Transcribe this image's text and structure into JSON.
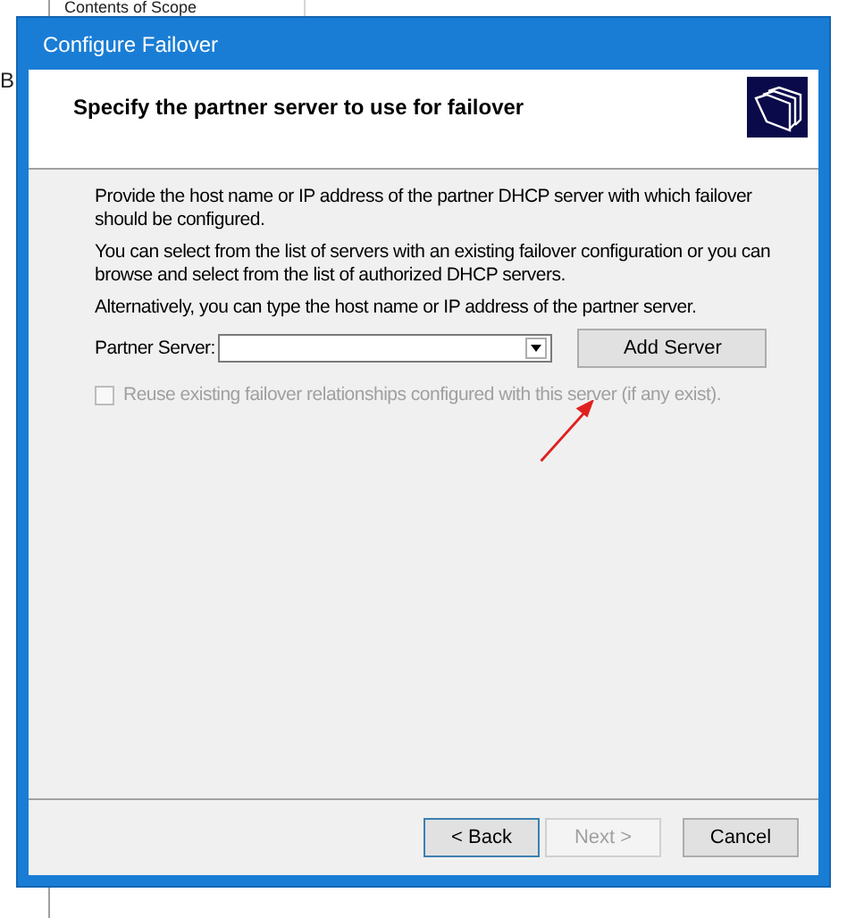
{
  "background": {
    "pane_header": "Contents of Scope",
    "left_fragment": "B"
  },
  "dialog": {
    "title": "Configure Failover",
    "heading": "Specify the partner server to use for failover",
    "paragraphs": [
      "Provide the host name or IP address of the partner DHCP server with which failover should be configured.",
      "You can select from the list of servers with an existing failover configuration or you can browse and select from the list of authorized DHCP servers.",
      "Alternatively, you can type the host name or IP address of the partner server."
    ],
    "partner_server": {
      "label": "Partner Server:"
    },
    "add_button": "Add Server",
    "reuse_checkbox": {
      "label": "Reuse existing failover relationships configured with this server (if any exist).",
      "checked": false,
      "disabled": true
    },
    "buttons": [
      {
        "label": "< Back",
        "disabled": false,
        "focused": true
      },
      {
        "label": "Next >",
        "disabled": true,
        "focused": false
      },
      {
        "label": "Cancel",
        "disabled": false,
        "focused": false
      }
    ]
  }
}
